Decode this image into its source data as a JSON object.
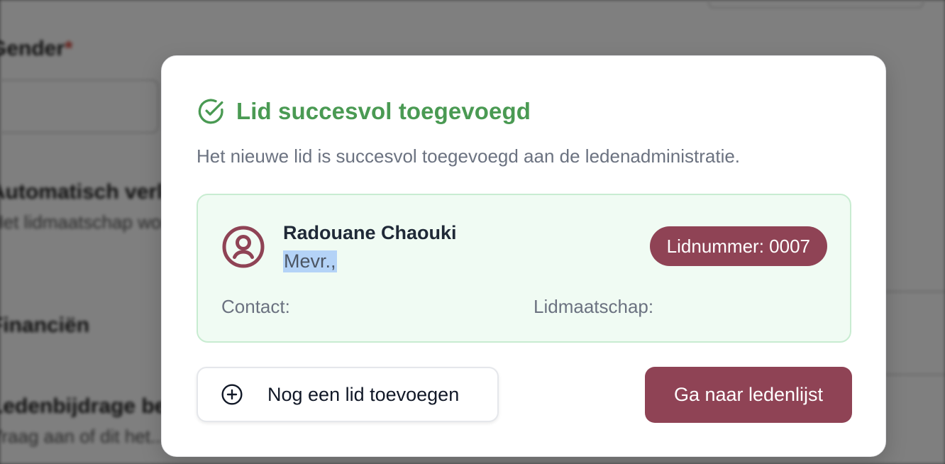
{
  "background": {
    "field_label": "Gender",
    "required_mark": "*",
    "section1_title": "Automatisch verlengen",
    "section1_sub": "Het lidmaatschap wordt",
    "section2_title": "Financiën",
    "section3_title": "Ledenbijdrage betalen",
    "section3_sub": "Vraag aan of dit het..."
  },
  "dialog": {
    "title": "Lid succesvol toegevoegd",
    "description": "Het nieuwe lid is succesvol toegevoegd aan de ledenadministratie.",
    "member": {
      "name": "Radouane Chaouki",
      "salutation": "Mevr.,",
      "member_number_badge": "Lidnummer: 0007",
      "contact_label": "Contact:",
      "membership_label": "Lidmaatschap:"
    },
    "buttons": {
      "add_another": "Nog een lid toevoegen",
      "go_to_list": "Ga naar ledenlijst"
    }
  },
  "colors": {
    "success": "#4a9a53",
    "brand": "#8f4355",
    "card_bg": "#f0fbf3",
    "card_border": "#c8ecd1"
  },
  "icons": {
    "title": "check-circle-icon",
    "avatar": "user-circle-icon",
    "add": "plus-circle-icon"
  }
}
